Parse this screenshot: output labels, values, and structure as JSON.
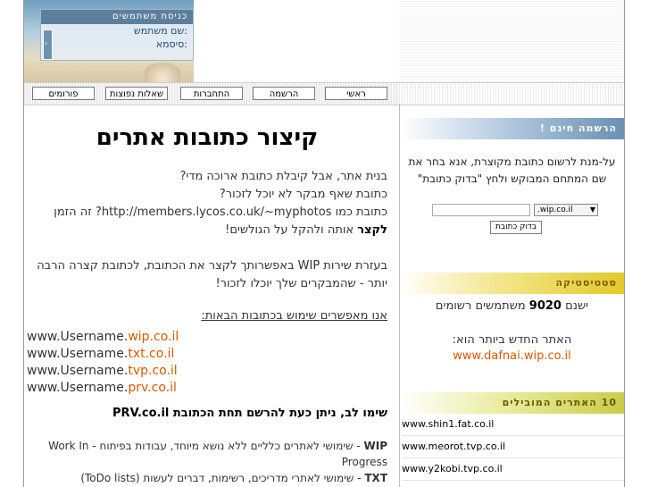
{
  "login": {
    "title": "כניסת משתמשים",
    "username_label": "שם משתמש:",
    "password_label": "סיסמא:",
    "submit_glyph": "›"
  },
  "nav": {
    "items": [
      "ראשי",
      "הרשמה",
      "התחברות",
      "שאלות נפוצות",
      "פורומים"
    ]
  },
  "main": {
    "title": "קיצור כתובות אתרים",
    "q1": "בנית אתר, אבל קיבלת כתובת ארוכה מדי?",
    "q2": "כתובת שאף מבקר לא יוכל לזכור?",
    "q3_pre": "כתובת כמו ",
    "q3_url": "http://members.lycos.co.uk/~myphotos",
    "q3_mid": "? זה הזמן ",
    "q3_bold": "לקצר",
    "q3_end": " אותה ולהקל על הגולשים!",
    "p2": "בעזרת שירות WIP באפשרותך לקצר את הכתובת, לכתובת קצרה הרבה יותר - שהמבקרים שלך יוכלו לזכור!",
    "examples_title": "אנו מאפשרים שימוש בכתובות הבאות:",
    "example_prefix": "www.Username.",
    "examples": [
      "wip.co.il",
      "txt.co.il",
      "tvp.co.il",
      "prv.co.il"
    ],
    "notice": "שימו לב, ניתן כעת להרשם תחת הכתובת PRV.co.il",
    "wip_label": "WIP",
    "wip_desc": " - שימושי לאתרים כלליים ללא נושא מיוחד, עבודות בפיתוח - Work In Progress",
    "txt_label": "TXT",
    "txt_desc": " - שימושי לאתרי מדריכים, רשימות, דברים לעשות (ToDo lists)"
  },
  "register": {
    "title": "הרשמה חינם !",
    "text": "על-מנת לרשום כתובת מקוצרת, אנא בחר את שם המתחם המבוקש ולחץ \"בדוק כתובת\"",
    "input_value": "",
    "suffix": ".wip.co.il",
    "button": "בדוק כתובת"
  },
  "stats": {
    "title": "סטטיסטיקה",
    "line_pre": "ישנם ",
    "users_count": "9020",
    "line_post": " משתמשים רשומים",
    "newest_label": "האתר החדש ביותר הוא:",
    "newest_site": "www.dafnai.wip.co.il"
  },
  "top_sites": {
    "title": "10 האתרים המובילים",
    "items": [
      "www.shin1.fat.co.il",
      "www.meorot.tvp.co.il",
      "www.y2kobi.tvp.co.il"
    ]
  },
  "colors": {
    "accent_orange": "#d45a00",
    "head_blue": "#6b90b4",
    "head_yellow": "#e3c928",
    "head_green": "#c9cc4a"
  }
}
